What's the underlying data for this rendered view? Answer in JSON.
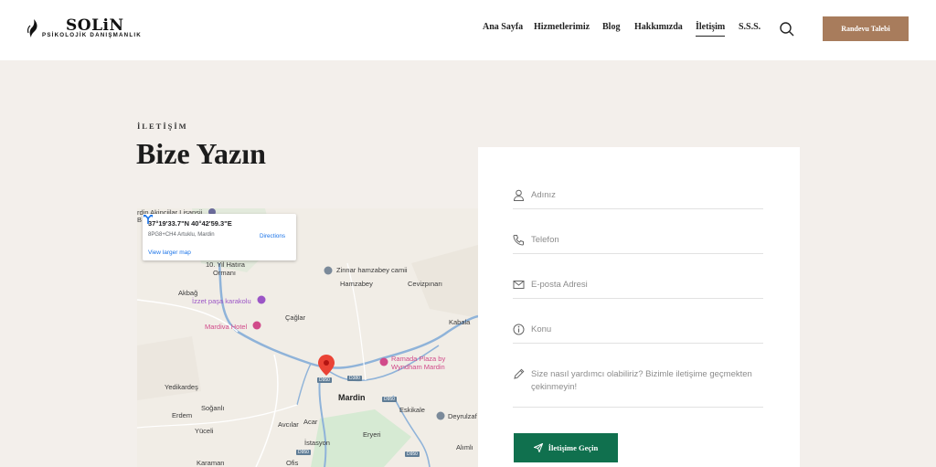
{
  "brand": {
    "title": "SOLiN",
    "subtitle": "PSİKOLOJİK DANIŞMANLIK"
  },
  "nav": [
    {
      "label": "Ana Sayfa"
    },
    {
      "label": "Hizmetlerimiz"
    },
    {
      "label": "Blog"
    },
    {
      "label": "Hakkımızda"
    },
    {
      "label": "İletişim",
      "active": true
    },
    {
      "label": "S.S.S."
    }
  ],
  "header": {
    "cta_label": "Randevu Talebi",
    "search_icon": "search-icon"
  },
  "hero": {
    "eyebrow": "İLETİŞİM",
    "title": "Bize Yazın"
  },
  "map": {
    "coords": "37°19'33.7\"N 40°42'59.3\"E",
    "plus_code": "8PG8+CH4 Artuklu, Mardin",
    "directions": "Directions",
    "larger_map": "View larger map",
    "labels": {
      "top_cut": "rdin Akinciilar Lisansii",
      "top_b": "B",
      "park_line1": "10. Yil Hatıra",
      "park_line2": "Ormanı",
      "zinnar": "Zinnar hamzabey camii",
      "akbag": "Akbağ",
      "hamzabey": "Hamzabey",
      "cevizpinari": "Cevizpınarı",
      "izzet": "İzzet paşa karakolu",
      "cağlar": "Çağlar",
      "kabala": "Kabala",
      "mardiva": "Mardiva Hotel",
      "ramada1": "Ramada Plaza by",
      "ramada2": "Wyndham Mardin",
      "yedikardes": "Yedikardeş",
      "mardin": "Mardin",
      "eskikale": "Eskikale",
      "deyrulzaf": "Deyrulzaf",
      "erdem": "Erdem",
      "soganli": "Soğanlı",
      "yuceli": "Yüceli",
      "avcilar": "Avcılar",
      "acar": "Acar",
      "eryeri": "Eryeri",
      "istasyon": "İstasyon",
      "alimli": "Alımlı",
      "karaman": "Karaman",
      "ofis": "Ofis"
    },
    "roads": {
      "d950a": "D950",
      "d380": "D380",
      "d950b": "D950",
      "d950c": "D950",
      "d950d": "D950"
    }
  },
  "form": {
    "name_placeholder": "Adınız",
    "phone_placeholder": "Telefon",
    "email_placeholder": "E-posta Adresi",
    "subject_placeholder": "Konu",
    "message_placeholder_line1": "Size nasıl yardımcı olabiliriz? Bizimle iletişime geçmekten",
    "message_placeholder_line2": "çekinmeyin!",
    "submit_label": "İletişime Geçin"
  },
  "colors": {
    "cta": "#a87c5c",
    "submit": "#10704e",
    "page_bg": "#f3efeb",
    "pin": "#ea4335"
  }
}
